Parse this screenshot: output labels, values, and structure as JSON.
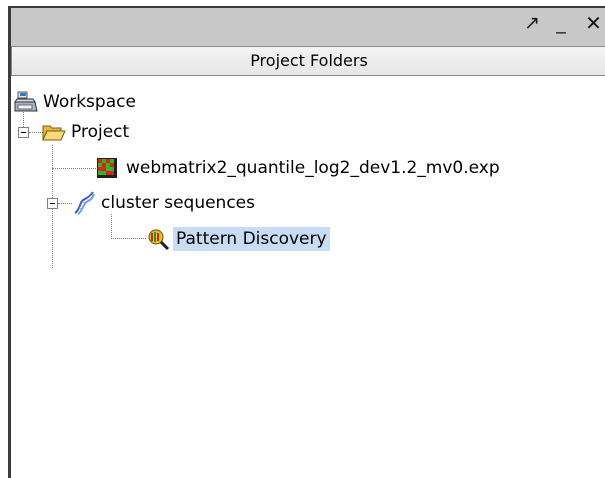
{
  "window": {
    "float_glyph": "↗",
    "minimize_glyph": "_",
    "close_glyph": "✕"
  },
  "panel": {
    "title": "Project Folders"
  },
  "tree": {
    "workspace": {
      "label": "Workspace",
      "icon": "workspace-icon"
    },
    "project": {
      "label": "Project",
      "icon": "folder-open-icon",
      "expanded": true
    },
    "experiment": {
      "label": "webmatrix2_quantile_log2_dev1.2_mv0.exp",
      "icon": "heatmap-icon"
    },
    "cluster": {
      "label": "cluster sequences",
      "icon": "dna-icon",
      "expanded": true
    },
    "pattern": {
      "label": "Pattern Discovery",
      "icon": "pattern-discovery-icon",
      "selected": true
    }
  },
  "colors": {
    "titlebar": "#c8c8c8",
    "selection": "#c8dcf4",
    "folder": "#f2c64a"
  }
}
